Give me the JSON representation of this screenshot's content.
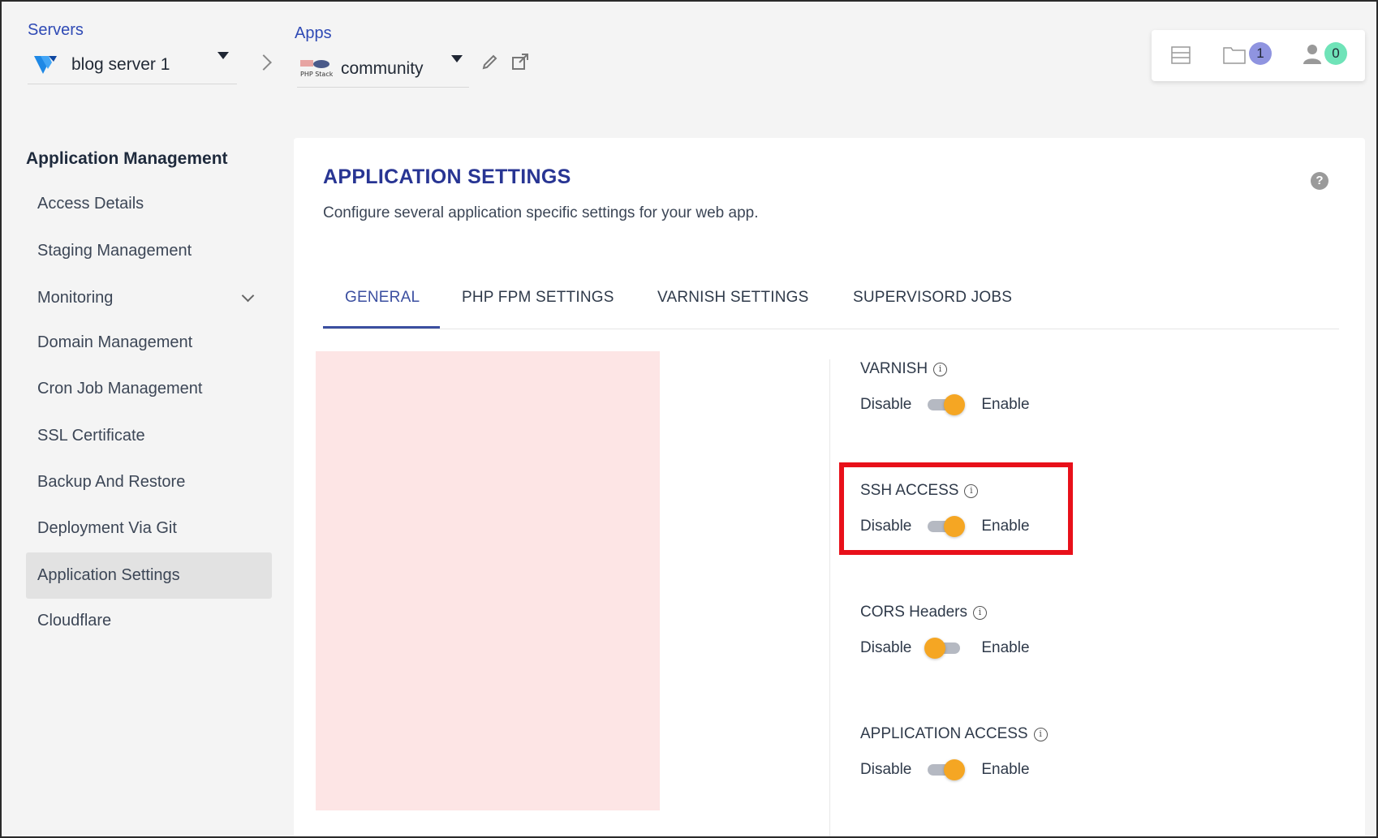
{
  "header": {
    "servers_label": "Servers",
    "server_name": "blog server 1",
    "apps_label": "Apps",
    "app_name": "community",
    "app_logo_text": "PHP Stack",
    "notifications_count": "1",
    "users_count": "0"
  },
  "sidebar": {
    "title": "Application Management",
    "items": [
      {
        "label": "Access Details"
      },
      {
        "label": "Staging Management"
      },
      {
        "label": "Monitoring"
      },
      {
        "label": "Domain Management"
      },
      {
        "label": "Cron Job Management"
      },
      {
        "label": "SSL Certificate"
      },
      {
        "label": "Backup And Restore"
      },
      {
        "label": "Deployment Via Git"
      },
      {
        "label": "Application Settings"
      },
      {
        "label": "Cloudflare"
      }
    ],
    "active_item": "Application Settings"
  },
  "main": {
    "title": "APPLICATION SETTINGS",
    "subtitle": "Configure several application specific settings for your web app.",
    "help_glyph": "?",
    "tabs": [
      {
        "label": "GENERAL"
      },
      {
        "label": "PHP FPM SETTINGS"
      },
      {
        "label": "VARNISH SETTINGS"
      },
      {
        "label": "SUPERVISORD JOBS"
      }
    ],
    "active_tab": "GENERAL",
    "settings": [
      {
        "label": "VARNISH",
        "off_label": "Disable",
        "on_label": "Enable",
        "enabled": true
      },
      {
        "label": "SSH ACCESS",
        "off_label": "Disable",
        "on_label": "Enable",
        "enabled": true
      },
      {
        "label": "CORS Headers",
        "off_label": "Disable",
        "on_label": "Enable",
        "enabled": false
      },
      {
        "label": "APPLICATION ACCESS",
        "off_label": "Disable",
        "on_label": "Enable",
        "enabled": true
      }
    ]
  },
  "colors": {
    "accent": "#283593",
    "toggle_knob": "#f5a623",
    "highlight": "#e8101a",
    "redacted": "#fde5e5",
    "badge_notifications": "#8f94e0",
    "badge_users": "#6fe3b8"
  }
}
